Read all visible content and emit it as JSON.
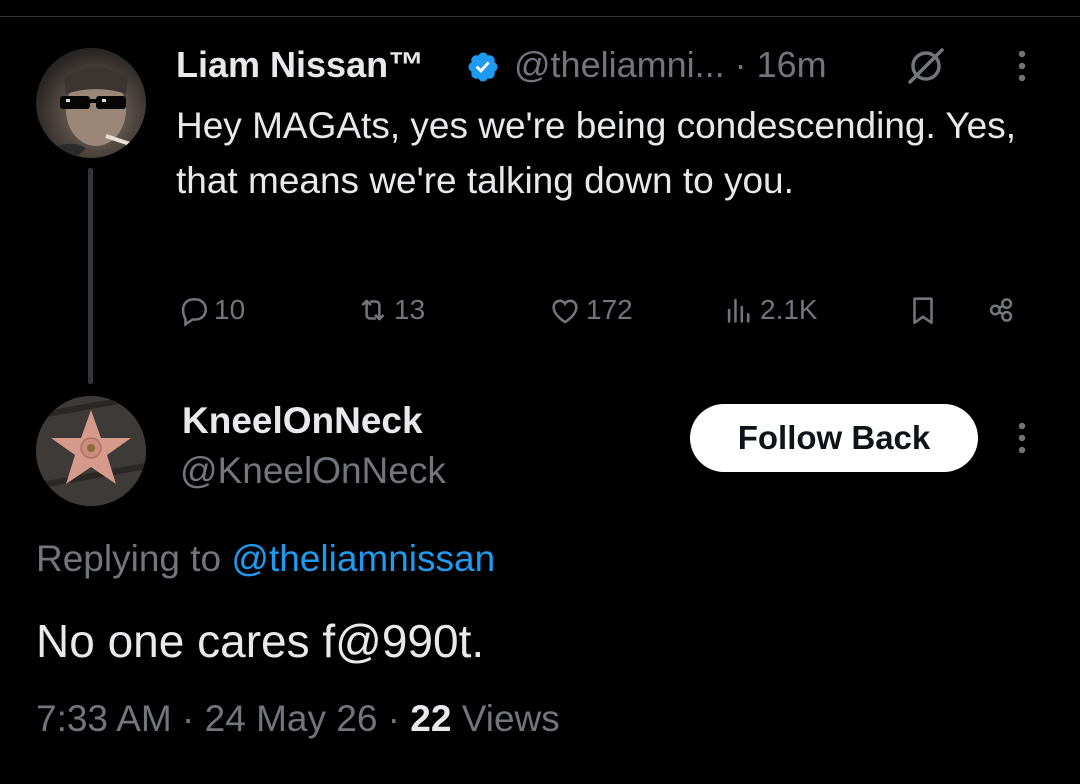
{
  "parent_tweet": {
    "author_name": "Liam Nissan™",
    "handle_time": "@theliamni... · 16m",
    "text": "Hey MAGAts, yes we're being condescending. Yes, that means we're talking down to you.",
    "actions": {
      "replies": "10",
      "reposts": "13",
      "likes": "172",
      "views": "2.1K"
    },
    "verified_color": "#1d9bf0"
  },
  "reply": {
    "author_name": "KneelOnNeck",
    "handle": "@KneelOnNeck",
    "follow_button_label": "Follow Back",
    "replying_to_prefix": "Replying to",
    "replying_to_mention": "@theliamnissan",
    "text": "No one cares f@990t.",
    "timestamp": "7:33 AM · 24 May 26 ·",
    "views_count": "22",
    "views_label": "Views"
  },
  "icons": [
    "grok-icon",
    "more-icon",
    "reply-icon",
    "repost-icon",
    "like-icon",
    "views-icon",
    "bookmark-icon",
    "share-icon",
    "verified-icon"
  ],
  "colors": {
    "background": "#000000",
    "text": "#e7e9ea",
    "muted": "#71767b",
    "accent": "#1d9bf0"
  }
}
